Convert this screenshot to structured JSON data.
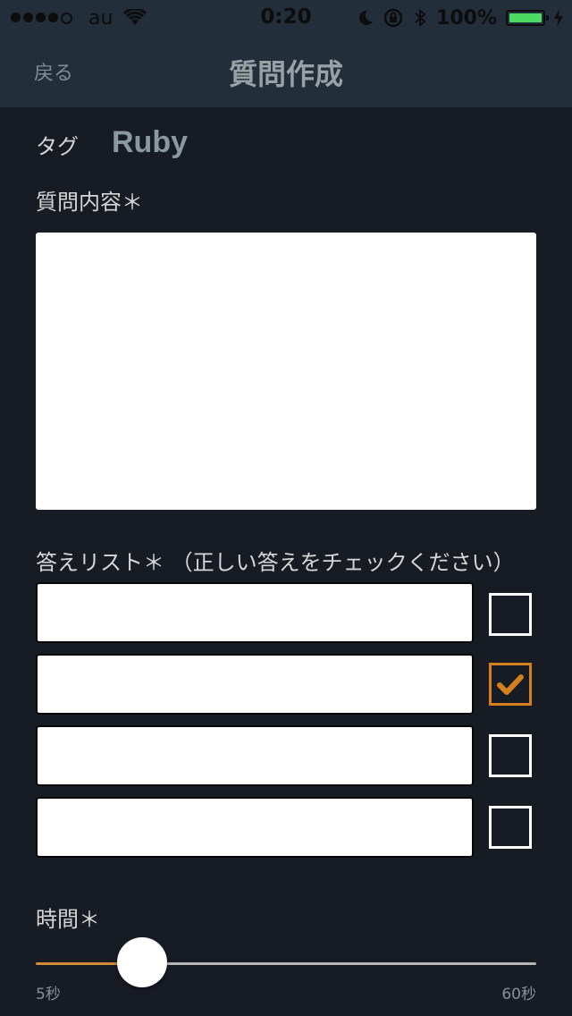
{
  "status_bar": {
    "carrier": "au",
    "time": "0:20",
    "battery": "100%",
    "signal_bars": 4
  },
  "nav": {
    "back": "戻る",
    "title": "質問作成"
  },
  "form": {
    "tag_label": "タグ",
    "tag_value": "Ruby",
    "question_label": "質問内容＊",
    "question_value": "",
    "answers_label": "答えリスト＊ （正しい答えをチェックください）",
    "answers": [
      {
        "value": "",
        "checked": false
      },
      {
        "value": "",
        "checked": true
      },
      {
        "value": "",
        "checked": false
      },
      {
        "value": "",
        "checked": false
      }
    ],
    "time_label": "時間＊",
    "time_slider": {
      "min_label": "5秒",
      "max_label": "60秒",
      "position_fraction": 0.21
    }
  },
  "colors": {
    "background": "#171b24",
    "navbar": "#232e3b",
    "accent": "#d67f1f",
    "battery": "#4cd964"
  }
}
